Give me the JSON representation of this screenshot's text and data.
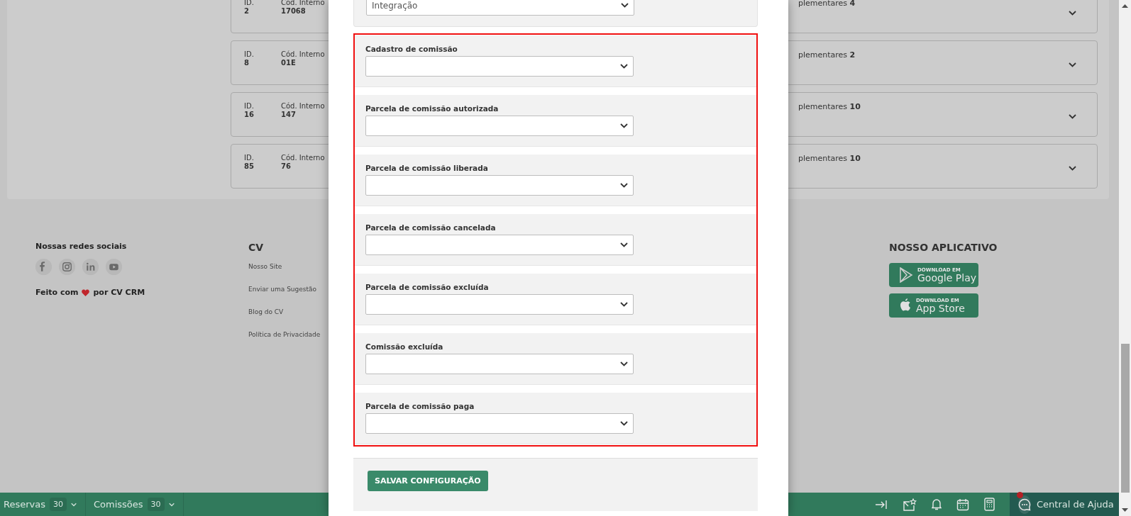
{
  "records": [
    {
      "id_label": "ID.",
      "id": "2",
      "code_label": "Cód. Interno",
      "code": "17068",
      "extra": "plementares **4**"
    },
    {
      "id_label": "ID.",
      "id": "8",
      "code_label": "Cód. Interno",
      "code": "01E",
      "extra": "plementares **2**"
    },
    {
      "id_label": "ID.",
      "id": "16",
      "code_label": "Cód. Interno",
      "code": "147",
      "extra": "plementares **10**"
    },
    {
      "id_label": "ID.",
      "id": "85",
      "code_label": "Cód. Interno",
      "code": "76",
      "extra": "plementares **10**"
    }
  ],
  "footer": {
    "social": {
      "title": "Nossas redes sociais",
      "made_with_before": "Feito com",
      "made_with_after": "por CV CRM"
    },
    "cv": {
      "title": "CV",
      "links": [
        "Nosso Site",
        "Enviar uma Sugestão",
        "Blog do CV",
        "Política de Privacidade"
      ]
    },
    "app": {
      "title": "NOSSO APLICATIVO",
      "stores": [
        {
          "kind": "google",
          "caption": "DOWNLOAD EM",
          "name": "Google Play"
        },
        {
          "kind": "apple",
          "caption": "DOWNLOAD EM",
          "name": "App Store"
        }
      ]
    }
  },
  "bottom_bar": {
    "tabs": [
      {
        "label": "Reservas",
        "count": "30"
      },
      {
        "label": "Comissões",
        "count": "30"
      }
    ],
    "help": {
      "label": "Central de Ajuda",
      "notification": true
    }
  },
  "modal": {
    "integration": {
      "value": "Integração"
    },
    "highlighted": true,
    "fields": [
      {
        "label": "Cadastro de comissão"
      },
      {
        "label": "Parcela de comissão autorizada"
      },
      {
        "label": "Parcela de comissão liberada"
      },
      {
        "label": "Parcela de comissão cancelada"
      },
      {
        "label": "Parcela de comissão excluída"
      },
      {
        "label": "Comissão excluída"
      },
      {
        "label": "Parcela de comissão paga"
      }
    ],
    "save_button": "SALVAR CONFIGURAÇÃO"
  }
}
